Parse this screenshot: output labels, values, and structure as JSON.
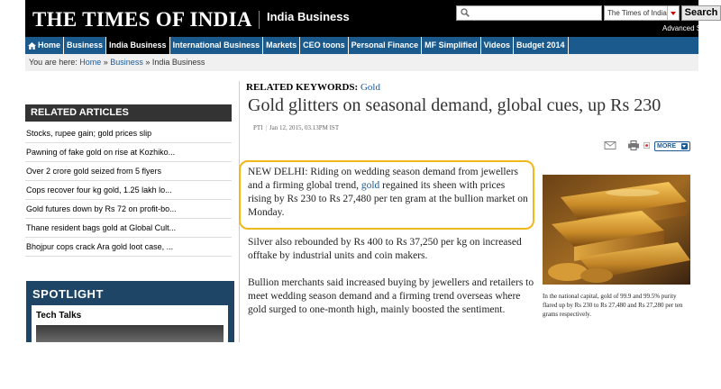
{
  "header": {
    "logo": "THE TIMES OF INDIA",
    "section": "India Business",
    "search_placeholder": "",
    "search_scope": "The Times of India",
    "search_button": "Search",
    "advanced_search": "Advanced Search »"
  },
  "nav": {
    "home": "Home",
    "items": [
      "Business",
      "India Business",
      "International Business",
      "Markets",
      "CEO toons",
      "Personal Finance",
      "MF Simplified",
      "Videos",
      "Budget 2014"
    ]
  },
  "breadcrumb": {
    "prefix": "You are here:",
    "home": "Home",
    "business": "Business",
    "current": "India Business",
    "sep": "»"
  },
  "related": {
    "title": "RELATED ARTICLES",
    "items": [
      "Stocks, rupee gain; gold prices slip",
      "Pawning of fake gold on rise at Kozhiko...",
      "Over 2 crore gold seized from 5 flyers",
      "Cops recover four kg gold, 1.25 lakh lo...",
      "Gold futures down by Rs 72 on profit-bo...",
      "Thane resident bags gold at Global Cult...",
      "Bhojpur cops crack Ara gold loot case, ..."
    ]
  },
  "spotlight": {
    "title": "SPOTLIGHT",
    "subtitle": "Tech Talks"
  },
  "article": {
    "keywords_label": "RELATED KEYWORDS:",
    "keyword": "Gold",
    "headline": "Gold glitters on seasonal demand, global cues, up Rs 230",
    "source": "PTI",
    "date": "Jan 12, 2015, 03.13PM IST",
    "more_label": "MORE",
    "lead_before": "NEW DELHI:  Riding on wedding season demand from jewellers and a firming global trend, ",
    "lead_link": "gold",
    "lead_after": " regained its sheen with prices rising by Rs 230 to Rs 27,480 per ten gram at the bullion market on Monday.",
    "para2": "Silver also rebounded by Rs 400 to Rs 37,250 per kg on increased offtake by industrial units and coin makers.",
    "para3": "Bullion merchants said increased buying by jewellers and retailers to meet wedding season demand and a firming trend overseas where gold surged to one-month high, mainly boosted the sentiment.",
    "image_caption": "In the national capital, gold of 99.9 and 99.5% purity flared up by Rs 230 to Rs 27,480 and Rs 27,280 per ten grams respectively."
  },
  "colors": {
    "nav_blue": "#1b5a8c",
    "link_blue": "#1a5a96",
    "highlight_gold": "#f0b81a",
    "spotlight_bg": "#1e4565"
  }
}
